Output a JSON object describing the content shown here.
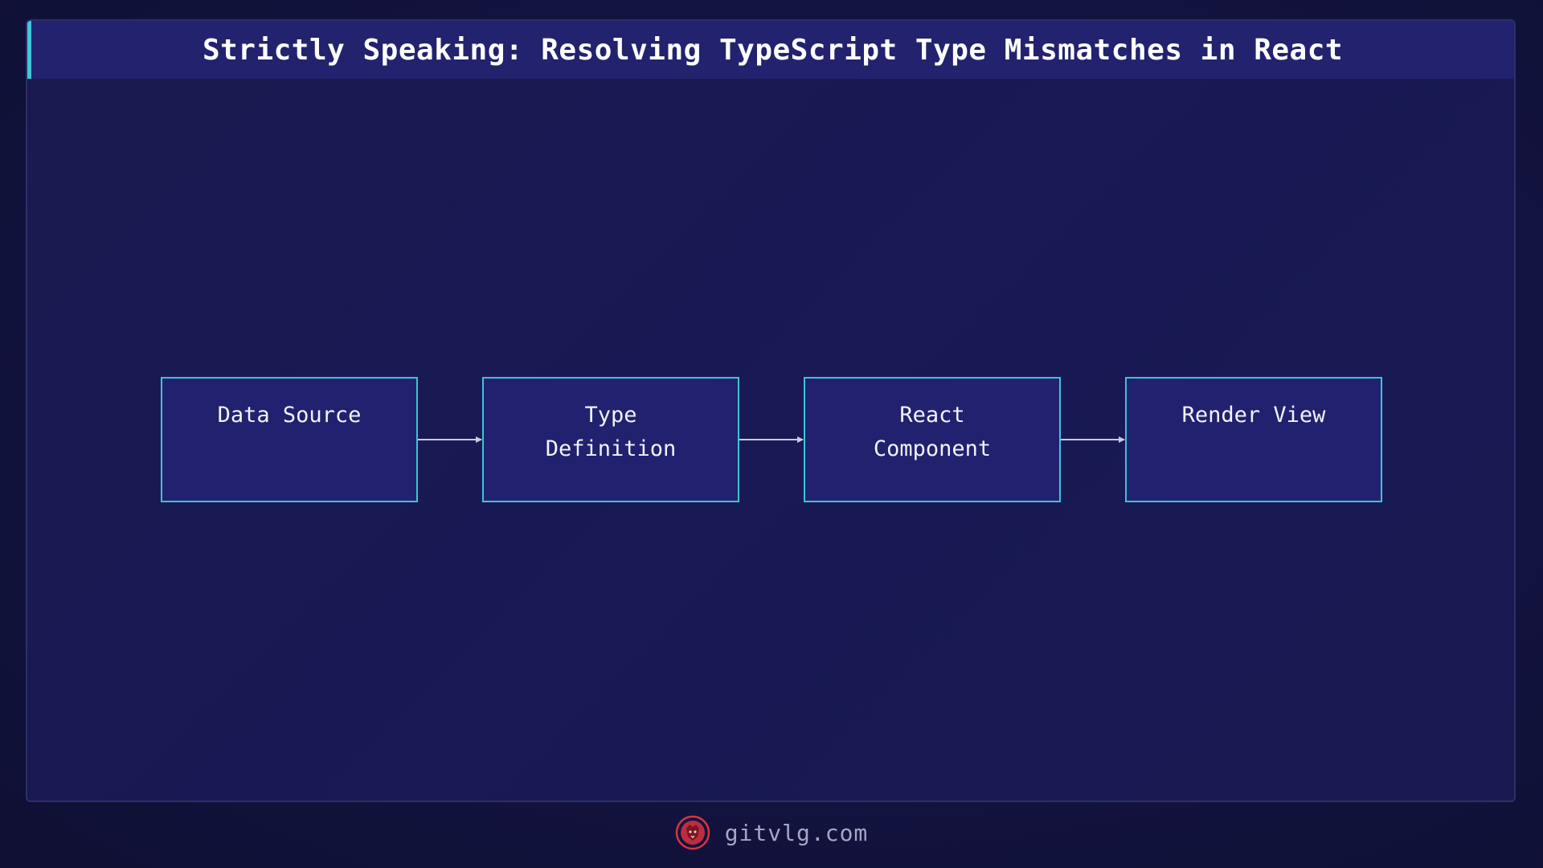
{
  "title": "Strictly Speaking: Resolving TypeScript Type Mismatches in React",
  "diagram": {
    "nodes": [
      {
        "id": "data-source",
        "lines": [
          "Data Source"
        ]
      },
      {
        "id": "type-definition",
        "lines": [
          "Type",
          "Definition"
        ]
      },
      {
        "id": "react-component",
        "lines": [
          "React",
          "Component"
        ]
      },
      {
        "id": "render-view",
        "lines": [
          "Render View"
        ]
      }
    ],
    "edges": [
      {
        "from": "data-source",
        "to": "type-definition"
      },
      {
        "from": "type-definition",
        "to": "react-component"
      },
      {
        "from": "react-component",
        "to": "render-view"
      }
    ]
  },
  "footer": {
    "site": "gitvlg.com",
    "logo_icon": "lion-logo-icon"
  },
  "colors": {
    "background": "#111238",
    "panel": "#1a1a52",
    "title_bar": "#23226f",
    "accent": "#40c8d6",
    "node_fill": "#22216f",
    "node_border": "#3fc3d3",
    "logo": "#d8343f"
  }
}
